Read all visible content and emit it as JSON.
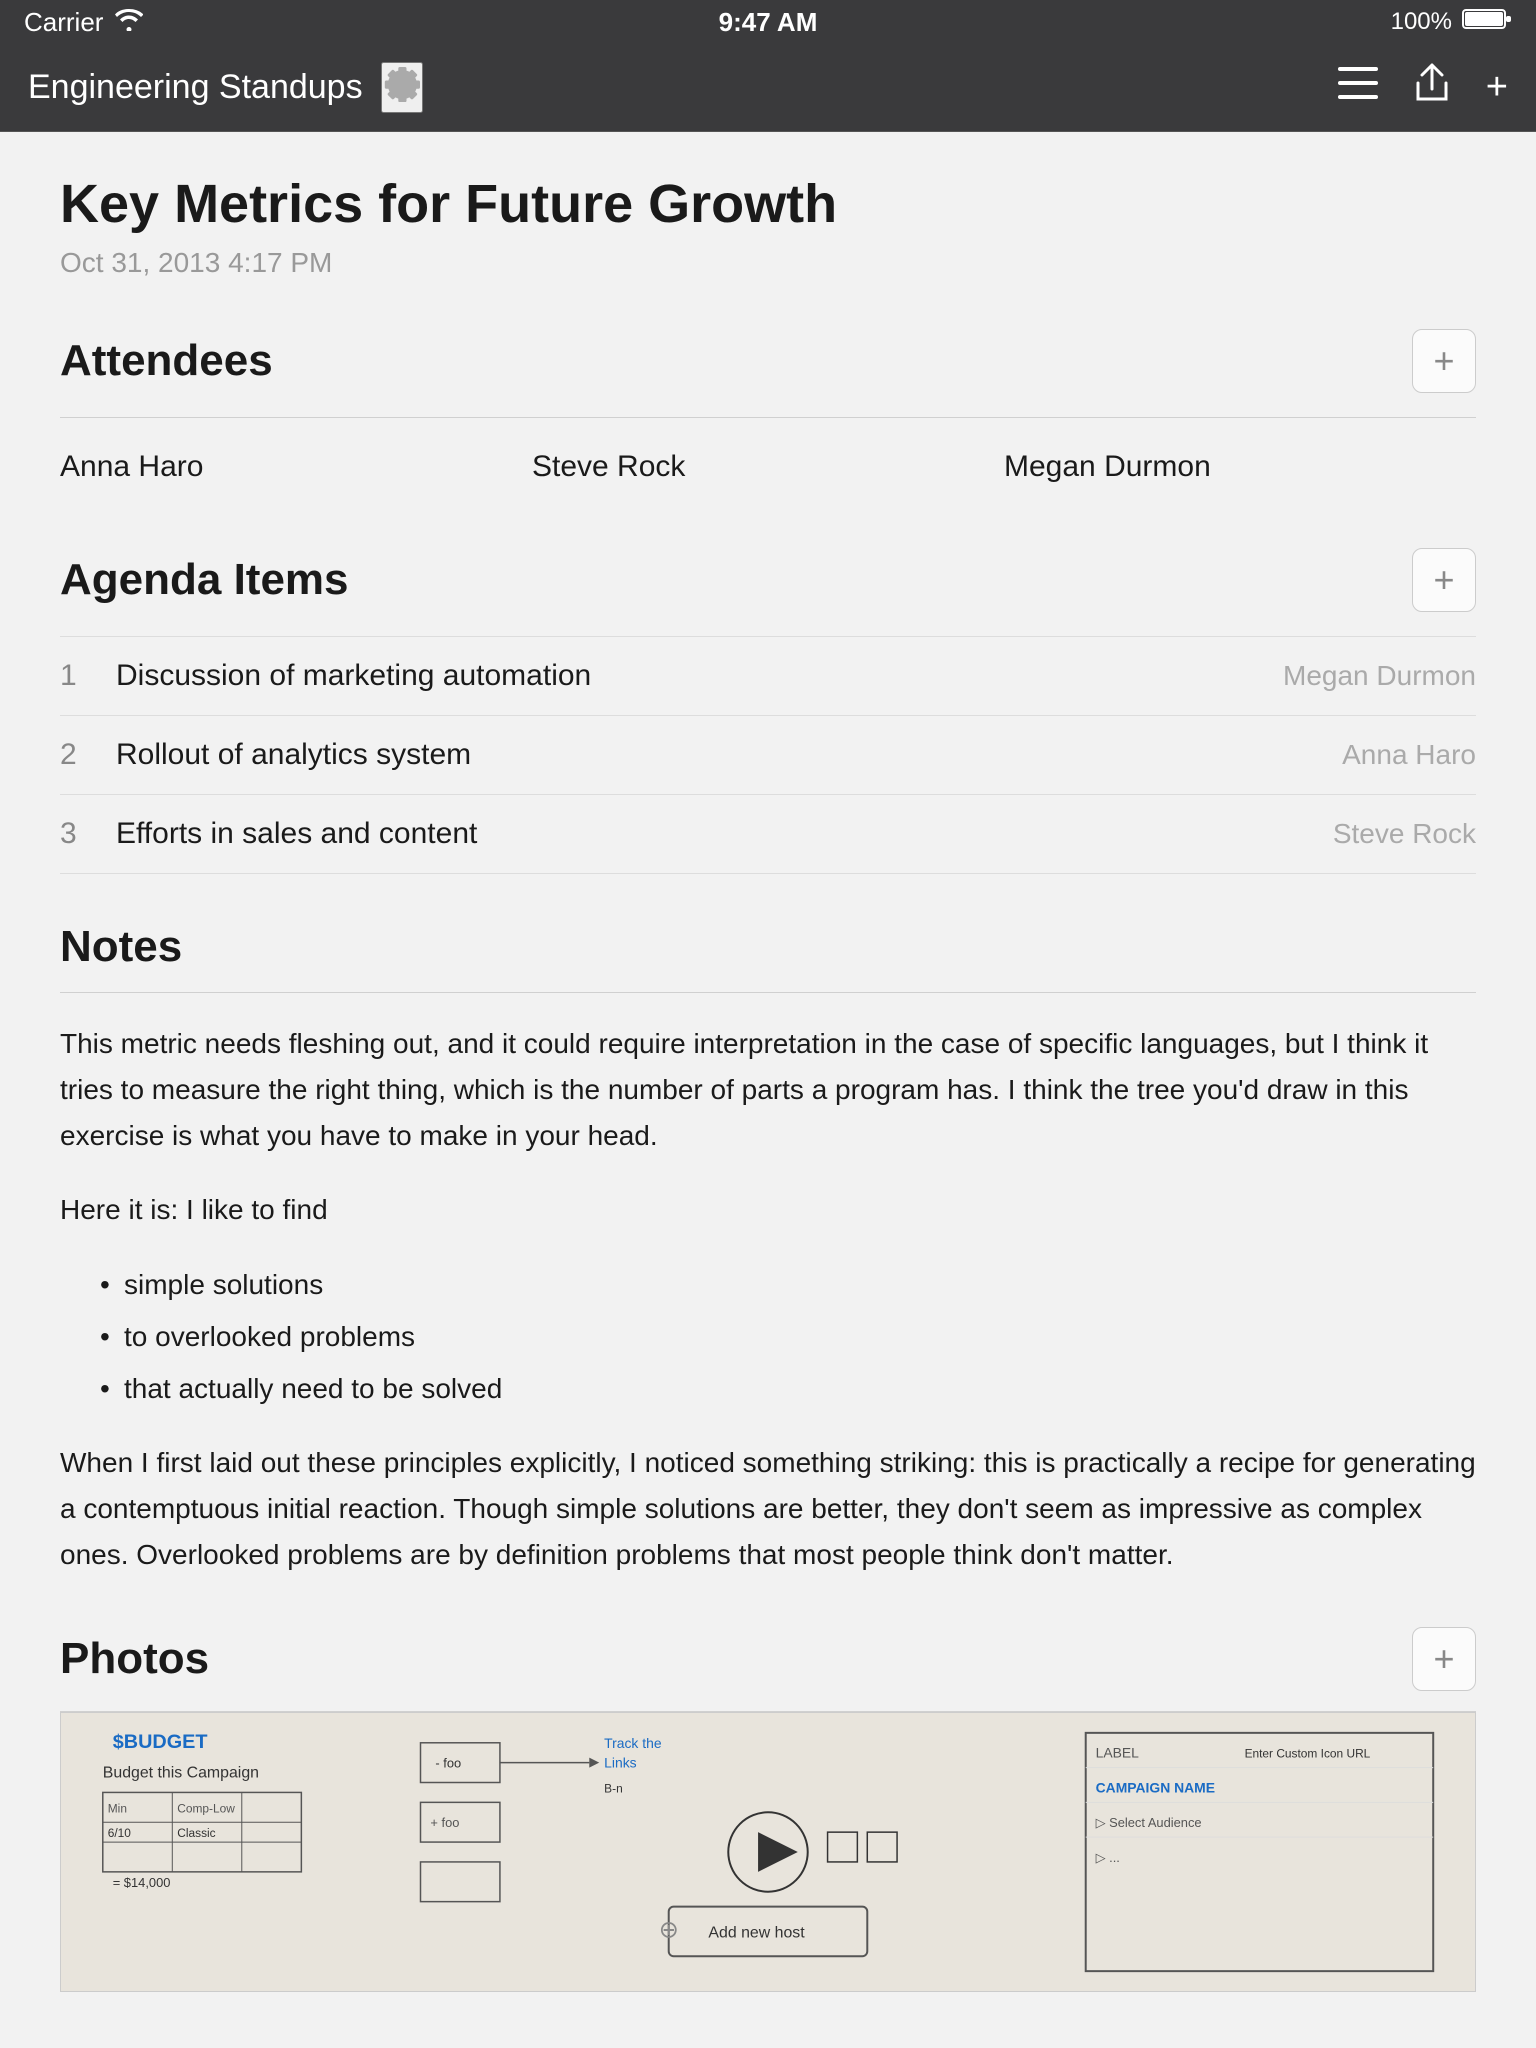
{
  "statusBar": {
    "carrier": "Carrier",
    "time": "9:47 AM",
    "battery": "100%"
  },
  "navBar": {
    "title": "Engineering Standups",
    "icons": {
      "hamburger": "≡",
      "share": "↑",
      "add": "+"
    }
  },
  "meeting": {
    "title": "Key Metrics for Future Growth",
    "datetime": "Oct 31, 2013  4:17 PM"
  },
  "attendees": {
    "sectionTitle": "Attendees",
    "list": [
      {
        "name": "Anna Haro"
      },
      {
        "name": "Steve Rock"
      },
      {
        "name": "Megan Durmon"
      }
    ]
  },
  "agendaItems": {
    "sectionTitle": "Agenda Items",
    "items": [
      {
        "num": "1",
        "text": "Discussion of marketing automation",
        "owner": "Megan Durmon"
      },
      {
        "num": "2",
        "text": "Rollout of analytics system",
        "owner": "Anna Haro"
      },
      {
        "num": "3",
        "text": "Efforts in sales and content",
        "owner": "Steve Rock"
      }
    ]
  },
  "notes": {
    "sectionTitle": "Notes",
    "paragraphs": [
      "This metric needs fleshing out, and it could require interpretation in the case of specific languages, but I think it tries to measure the right thing, which is the number of parts a program has. I think the tree you'd draw in this exercise is what you have to make in your head.",
      "Here it is: I like to find"
    ],
    "bullets": [
      "simple solutions",
      "to overlooked problems",
      "that actually need to be solved"
    ],
    "paragraph2": "When I first laid out these principles explicitly, I noticed something striking: this is practically a recipe for generating a contemptuous initial reaction. Though simple solutions are better, they don't seem as impressive as complex ones. Overlooked problems are by definition problems that most people think don't matter."
  },
  "photos": {
    "sectionTitle": "Photos",
    "addLabel": "+"
  },
  "addLabel": "+"
}
